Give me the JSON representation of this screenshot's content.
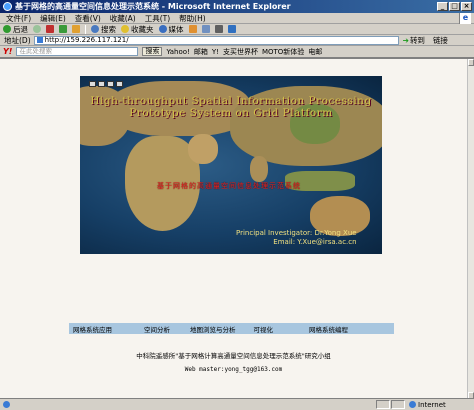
{
  "window": {
    "title": "基于网格的高通量空间信息处理示范系统 - Microsoft Internet Explorer",
    "buttons": [
      "_",
      "□",
      "×"
    ]
  },
  "menu": [
    "文件(F)",
    "编辑(E)",
    "查看(V)",
    "收藏(A)",
    "工具(T)",
    "帮助(H)"
  ],
  "toolbar": {
    "back": "后退",
    "search": "搜索",
    "favorites": "收藏夹",
    "media": "媒体"
  },
  "address": {
    "label": "地址(D)",
    "url": "http://159.226.117.121/",
    "go": "转到",
    "links": "链接"
  },
  "searchbar": {
    "logo": "Y!",
    "placeholder": "在此处搜索",
    "search_button": "搜索",
    "items": [
      "Yahoo!",
      "邮箱",
      "Y!",
      "支买世界杯",
      "MOTO新体验",
      "电邮"
    ]
  },
  "banner": {
    "title_line1": "High-throughput Spatial Information Processing",
    "title_line2": "Prototype System on Grid Platform",
    "cn_title": "基于网格的高通量空间信息处理示范系统",
    "pi_line1": "Principal Investigator: Dr.Yong Xue",
    "pi_line2": "Email: Y.Xue@irsa.ac.cn"
  },
  "nav": [
    "网格系统应用",
    "空间分析",
    "地图浏览与分析",
    "可视化",
    "网格系统编程"
  ],
  "footer": {
    "line1": "中科院遥感所\"基于网格计算高通量空间信息处理示范系统\"研究小组",
    "line2": "Web master:yong_tgg@163.com"
  },
  "status": {
    "zone": "Internet"
  }
}
